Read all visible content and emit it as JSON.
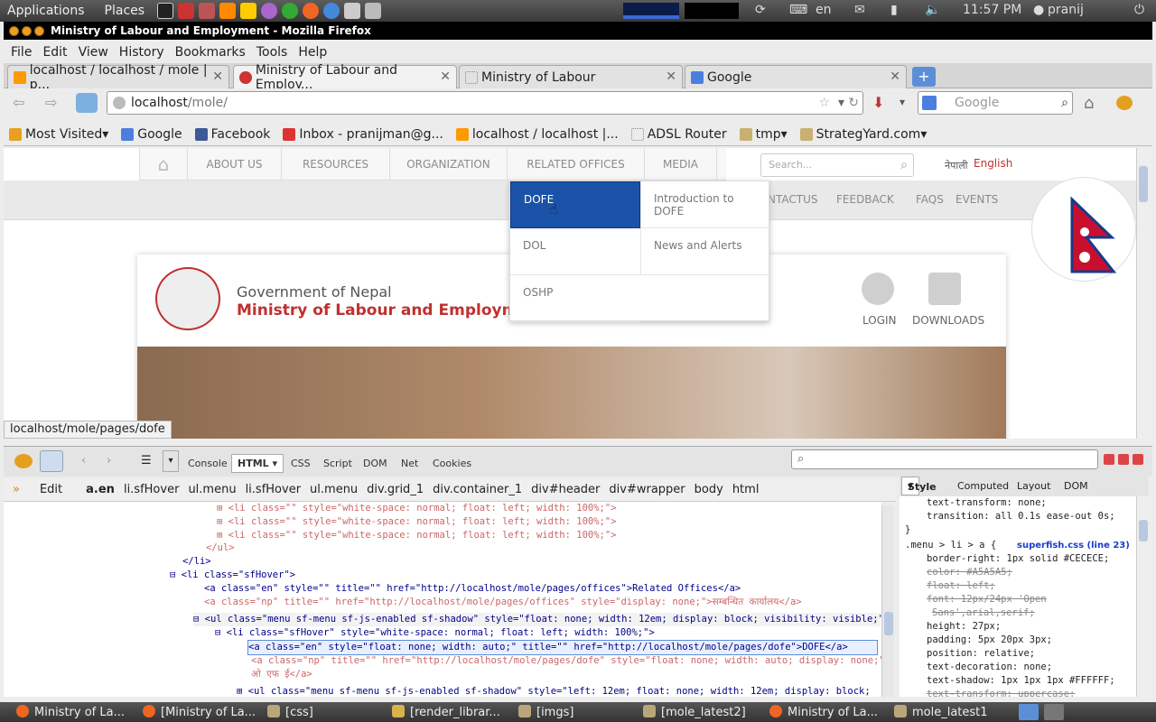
{
  "gnome_panel": {
    "applications": "Applications",
    "places": "Places",
    "lang": "en",
    "time": "11:57 PM",
    "user": "pranij"
  },
  "window": {
    "title": "Ministry of Labour and Employment - Mozilla Firefox"
  },
  "menubar": [
    "File",
    "Edit",
    "View",
    "History",
    "Bookmarks",
    "Tools",
    "Help"
  ],
  "tabs": [
    {
      "label": "localhost / localhost / mole | p..."
    },
    {
      "label": "Ministry of Labour and Employ..."
    },
    {
      "label": "Ministry of Labour"
    },
    {
      "label": "Google"
    }
  ],
  "url": {
    "host": "localhost",
    "path": "/mole/"
  },
  "search": {
    "placeholder": "Google"
  },
  "bookmarks": [
    "Most Visited",
    "Google",
    "Facebook",
    "Inbox - pranijman@g...",
    "localhost / localhost |...",
    "ADSL Router",
    "tmp",
    "StrategYard.com"
  ],
  "site": {
    "nav": [
      "ABOUT US",
      "RESOURCES",
      "ORGANIZATION",
      "RELATED OFFICES",
      "MEDIA"
    ],
    "search_placeholder": "Search...",
    "lang_np": "नेपाली",
    "lang_en": "English",
    "sublinks": [
      "NTACTUS",
      "FEEDBACK",
      "FAQS",
      "EVENTS"
    ],
    "govt": "Government of Nepal",
    "ministry": "Ministry of Labour and Employment",
    "login": "LOGIN",
    "downloads": "DOWNLOADS",
    "dropdown_left": [
      "DOFE",
      "DOL",
      "OSHP"
    ],
    "dropdown_right": [
      "Introduction to DOFE",
      "News and Alerts"
    ]
  },
  "status_url": "localhost/mole/pages/dofe",
  "firebug": {
    "tabs": [
      "Console",
      "HTML",
      "CSS",
      "Script",
      "DOM",
      "Net",
      "Cookies"
    ],
    "edit": "Edit",
    "crumbs": [
      "a.en",
      "li.sfHover",
      "ul.menu",
      "li.sfHover",
      "ul.menu",
      "div.grid_1",
      "div.container_1",
      "div#header",
      "div#wrapper",
      "body",
      "html"
    ],
    "side_tabs": [
      "Style",
      "Computed",
      "Layout",
      "DOM"
    ],
    "code_lines": [
      "<li class=\"\" style=\"white-space: normal; float: left; width: 100%;\">",
      "<li class=\"\" style=\"white-space: normal; float: left; width: 100%;\">",
      "<li class=\"\" style=\"white-space: normal; float: left; width: 100%;\">",
      "</ul>",
      "</li>",
      "<li class=\"sfHover\">",
      "<a class=\"en\" style=\"\" title=\"\" href=\"http://localhost/mole/pages/offices\">Related Offices</a>",
      "<a class=\"np\" title=\"\" href=\"http://localhost/mole/pages/offices\" style=\"display: none;\">सम्बन्धित कार्यालय</a>",
      "<ul class=\"menu sf-menu sf-js-enabled sf-shadow\" style=\"float: none; width: 12em; display: block; visibility: visible;\">",
      "<li class=\"sfHover\" style=\"white-space: normal; float: left; width: 100%;\">",
      "<a class=\"en\" style=\"float: none; width: auto;\" title=\"\" href=\"http://localhost/mole/pages/dofe\">DOFE</a>",
      "<a class=\"np\" title=\"\" href=\"http://localhost/mole/pages/dofe\" style=\"float: none; width: auto; display: none;\">डि",
      "ओ एफ ई</a>",
      "<ul class=\"menu sf-menu sf-js-enabled sf-shadow\" style=\"left: 12em; float: none; width: 12em; display: block;"
    ],
    "style_lines": [
      "text-transform: none;",
      "transition: all 0.1s ease-out 0s;",
      "}",
      ".menu > li > a {",
      "superfish.css (line 23)",
      "border-right: 1px solid #CECECE;",
      "color: #A5A5A5;",
      "float: left;",
      "font: 12px/24px 'Open",
      "Sans',arial,serif;",
      "height: 27px;",
      "padding: 5px 20px 3px;",
      "position: relative;",
      "text-decoration: none;",
      "text-shadow: 1px 1px 1px #FFFFFF;",
      "text-transform: uppercase;"
    ]
  },
  "taskbar": [
    "Ministry of La...",
    "[Ministry of La...",
    "[css]",
    "[render_librar...",
    "[imgs]",
    "[mole_latest2]",
    "Ministry of La...",
    "mole_latest1"
  ]
}
